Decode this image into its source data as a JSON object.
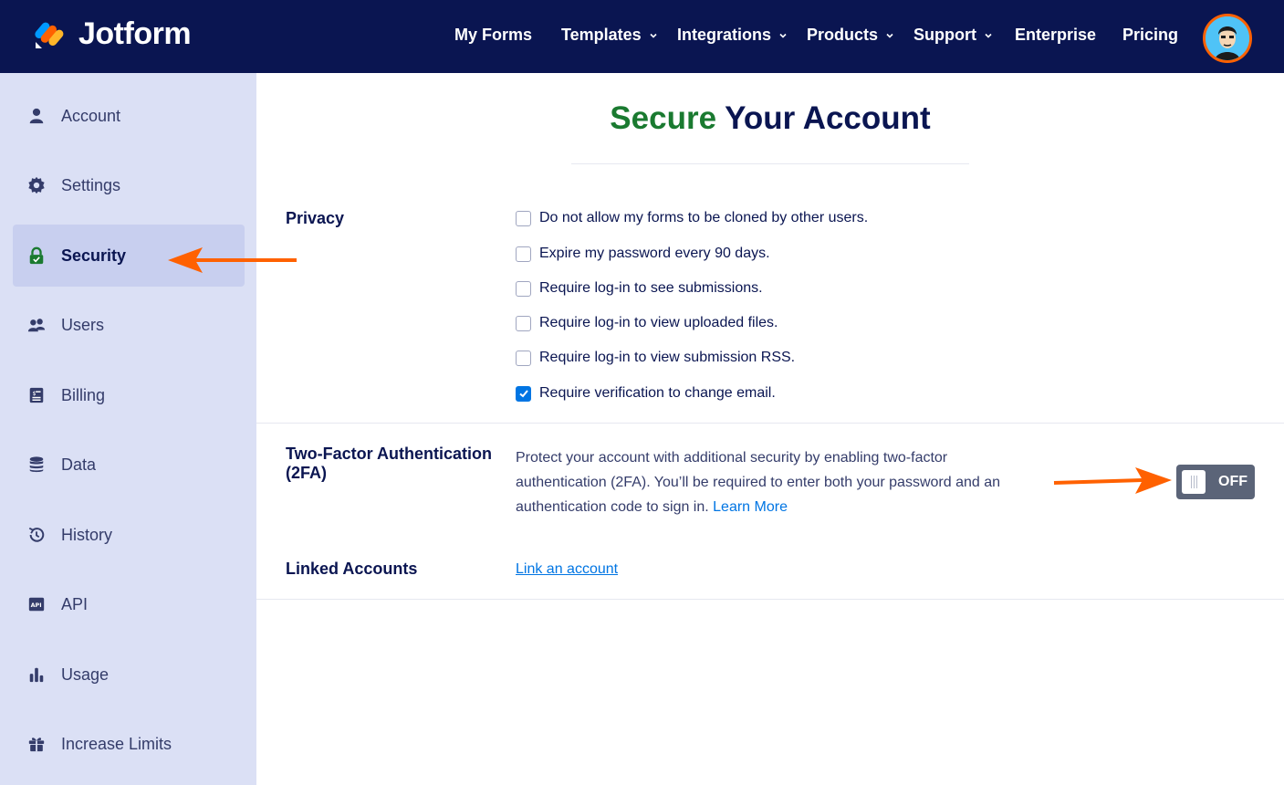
{
  "header": {
    "logo_text": "Jotform",
    "nav": [
      {
        "label": "My Forms",
        "dropdown": false
      },
      {
        "label": "Templates",
        "dropdown": true
      },
      {
        "label": "Integrations",
        "dropdown": true
      },
      {
        "label": "Products",
        "dropdown": true
      },
      {
        "label": "Support",
        "dropdown": true
      },
      {
        "label": "Enterprise",
        "dropdown": false
      },
      {
        "label": "Pricing",
        "dropdown": false
      }
    ]
  },
  "sidebar": {
    "items": [
      {
        "label": "Account",
        "icon": "user-icon",
        "active": false
      },
      {
        "label": "Settings",
        "icon": "gear-icon",
        "active": false
      },
      {
        "label": "Security",
        "icon": "lock-icon",
        "active": true
      },
      {
        "label": "Users",
        "icon": "users-icon",
        "active": false
      },
      {
        "label": "Billing",
        "icon": "billing-icon",
        "active": false
      },
      {
        "label": "Data",
        "icon": "database-icon",
        "active": false
      },
      {
        "label": "History",
        "icon": "history-icon",
        "active": false
      },
      {
        "label": "API",
        "icon": "api-icon",
        "active": false
      },
      {
        "label": "Usage",
        "icon": "bar-chart-icon",
        "active": false
      },
      {
        "label": "Increase Limits",
        "icon": "gift-icon",
        "active": false
      }
    ]
  },
  "main": {
    "title_accent": "Secure",
    "title_rest": " Your Account",
    "privacy": {
      "label": "Privacy",
      "options": [
        {
          "label": "Do not allow my forms to be cloned by other users.",
          "checked": false
        },
        {
          "label": "Expire my password every 90 days.",
          "checked": false
        },
        {
          "label": "Require log-in to see submissions.",
          "checked": false
        },
        {
          "label": "Require log-in to view uploaded files.",
          "checked": false
        },
        {
          "label": "Require log-in to view submission RSS.",
          "checked": false
        },
        {
          "label": "Require verification to change email.",
          "checked": true
        }
      ]
    },
    "twofa": {
      "label": "Two-Factor Authentication (2FA)",
      "description": "Protect your account with additional security by enabling two-factor authentication (2FA). You’ll be required to enter both your password and an authentication code to sign in.",
      "learn_more": "Learn More",
      "toggle_state": "OFF"
    },
    "linked": {
      "label": "Linked Accounts",
      "link_text": "Link an account"
    }
  },
  "colors": {
    "header_bg": "#0a1551",
    "sidebar_bg": "#dbe0f5",
    "active_item_bg": "#c8cfef",
    "accent_green": "#1a7a30",
    "link_blue": "#0075e3",
    "annotation_arrow": "#ff6100",
    "toggle_bg": "#5b6478"
  }
}
